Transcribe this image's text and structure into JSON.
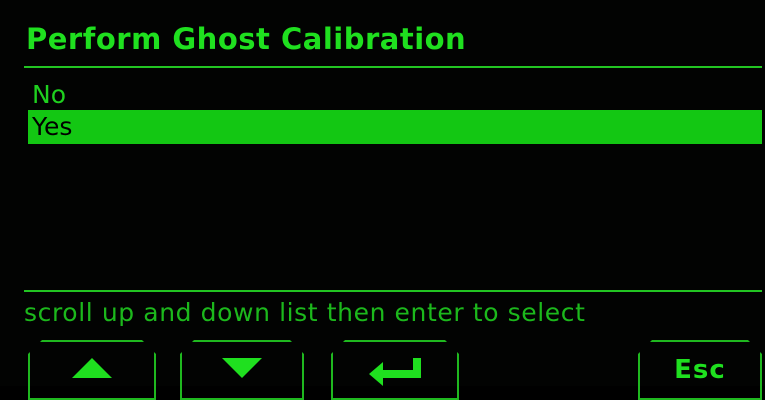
{
  "screen": {
    "title": "Perform Ghost Calibration",
    "options": [
      {
        "label": "No",
        "selected": false
      },
      {
        "label": "Yes",
        "selected": true
      }
    ],
    "hint": "scroll up and down list then enter to select"
  },
  "softkeys": {
    "up_icon": "arrow-up-icon",
    "down_icon": "arrow-down-icon",
    "enter_icon": "enter-icon",
    "esc_label": "Esc"
  },
  "colors": {
    "foreground": "#1fe01f",
    "selection": "#13c713",
    "background": "#020302"
  }
}
